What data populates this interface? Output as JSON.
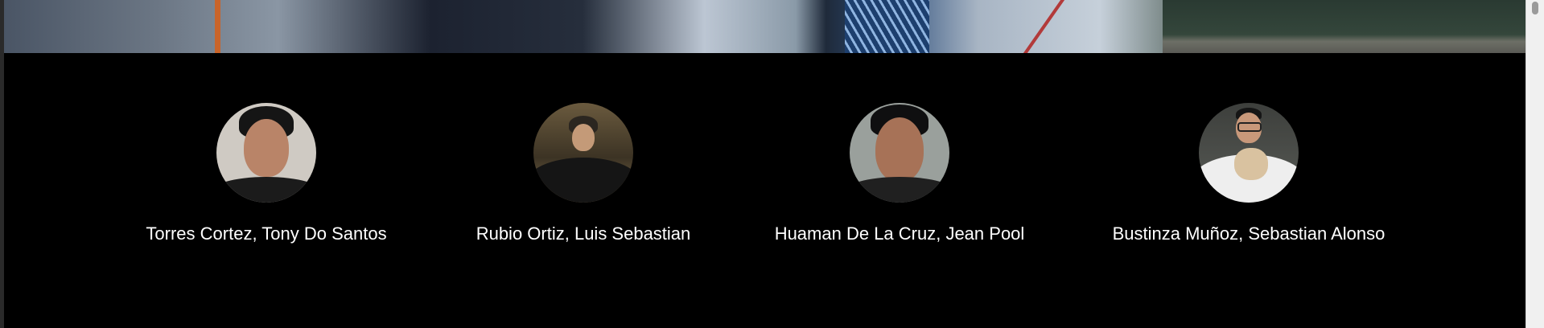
{
  "team": {
    "members": [
      {
        "name": "Torres Cortez, Tony Do Santos",
        "photo": "profile photo"
      },
      {
        "name": "Rubio Ortiz, Luis Sebastian",
        "photo": "profile photo"
      },
      {
        "name": "Huaman De La Cruz, Jean Pool",
        "photo": "profile photo"
      },
      {
        "name": "Bustinza Muñoz, Sebastian Alonso",
        "photo": "profile photo"
      }
    ]
  },
  "colors": {
    "background": "#000000",
    "text": "#ffffff",
    "scrollbar": "#f0f0f0"
  }
}
